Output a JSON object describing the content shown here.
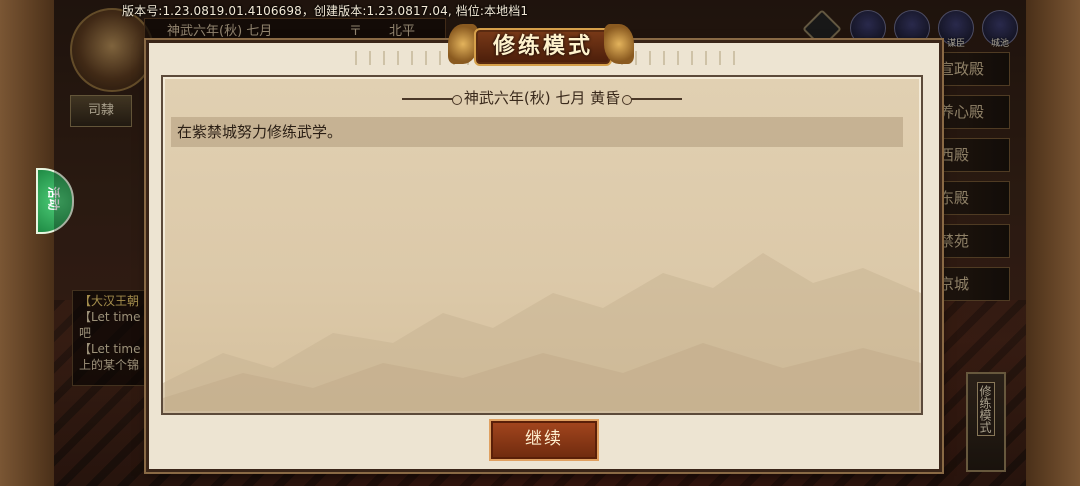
{
  "version_text": "版本号:1.23.0819.01.4106698，创建版本:1.23.0817.04, 档位:本地档1",
  "top_info": {
    "date": "神武六年(秋) 七月",
    "separator": "〒",
    "location": "北平"
  },
  "rank_badge": "司隸",
  "green_tab": "活动",
  "chat_log": {
    "lines": [
      {
        "text": "【大汉王朝",
        "color": "gold"
      },
      {
        "text": "【Let time",
        "color": "normal"
      },
      {
        "text": "吧",
        "color": "normal"
      },
      {
        "text": "【Let time",
        "color": "normal"
      },
      {
        "text": "上的某个锦",
        "color": "normal"
      }
    ]
  },
  "top_icons": [
    {
      "name": "diamond-icon",
      "label": ""
    },
    {
      "name": "scroll-icon",
      "label": "奏折"
    },
    {
      "name": "helmet-icon",
      "label": "将领"
    },
    {
      "name": "officer-icon",
      "label": "谋臣"
    },
    {
      "name": "city-icon",
      "label": "城池"
    }
  ],
  "right_menu": [
    "宣政殿",
    "养心殿",
    "西殿",
    "东殿",
    "禁苑",
    "京城"
  ],
  "side_mode_button": "修练模式",
  "modal": {
    "title": "修练模式",
    "header": "神武六年(秋) 七月 黄昏",
    "log_line": "在紫禁城努力修练武学。",
    "continue_label": "继续"
  },
  "colors": {
    "panel": "#dcc9a9",
    "accent": "#a4461e",
    "frame": "#3a2518"
  }
}
